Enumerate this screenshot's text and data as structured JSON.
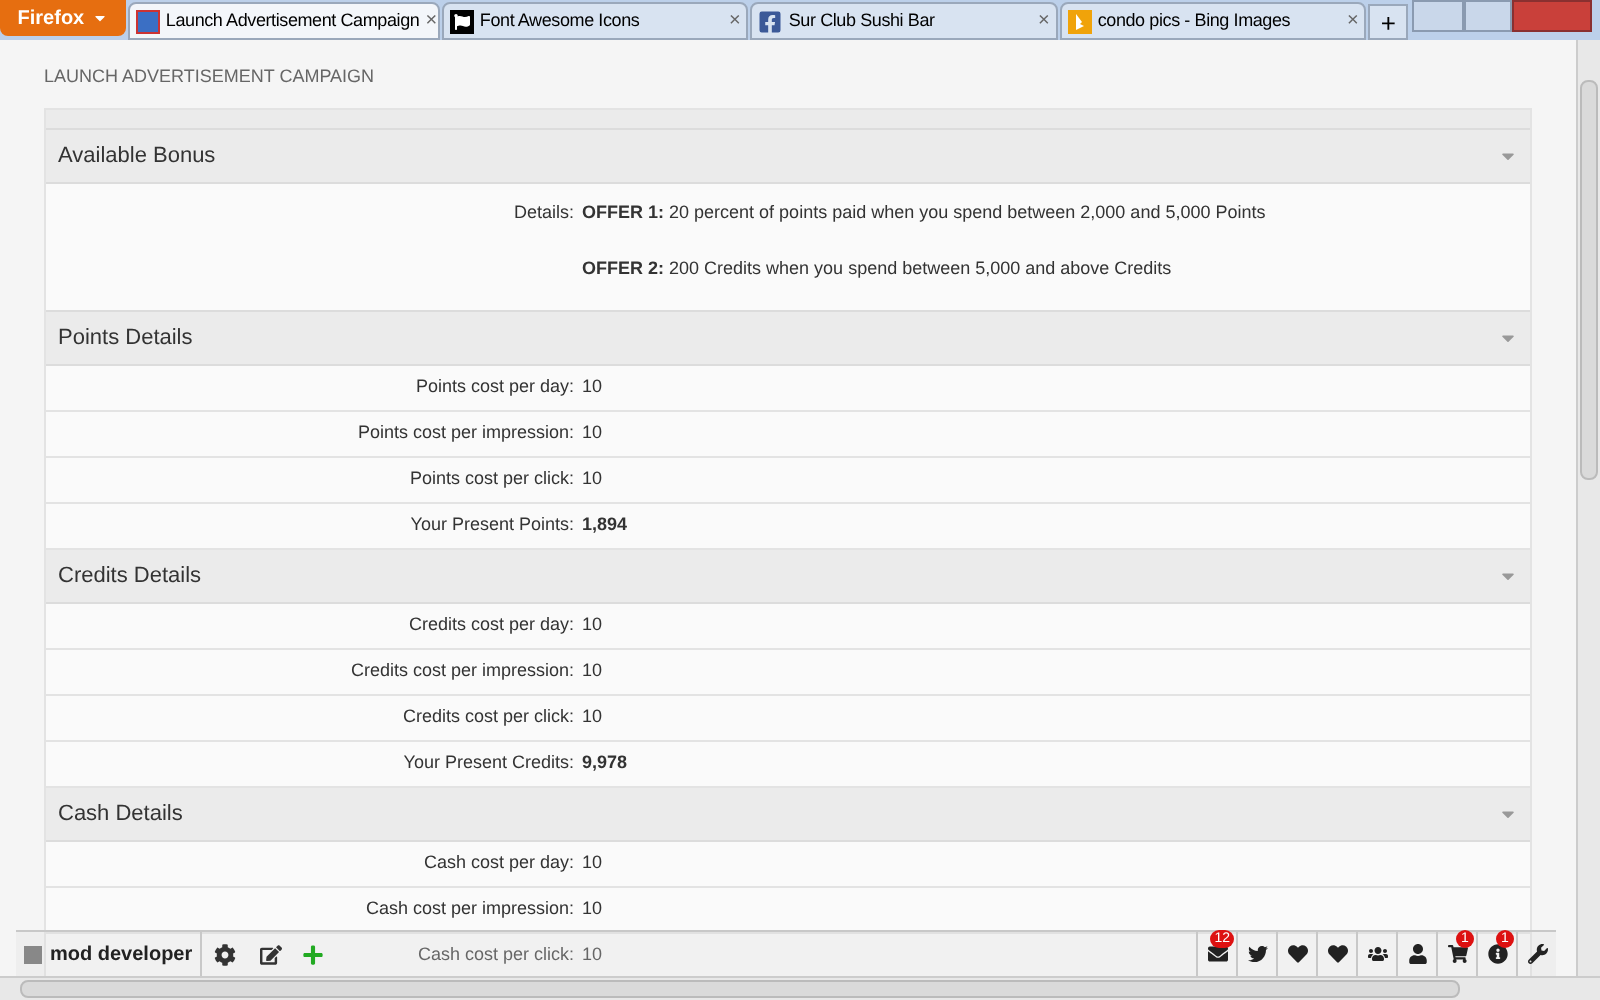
{
  "browser": {
    "menu_button": "Firefox",
    "tabs": [
      {
        "label": "Launch Advertisement Campaign",
        "selected": true,
        "kind": "app",
        "close": "×"
      },
      {
        "label": "Font Awesome Icons",
        "selected": false,
        "kind": "flag",
        "close": "×"
      },
      {
        "label": "Sur Club Sushi Bar",
        "selected": false,
        "kind": "facebook",
        "close": "×"
      },
      {
        "label": "condo pics - Bing Images",
        "selected": false,
        "kind": "bing",
        "close": "×"
      }
    ],
    "new_tab": "+"
  },
  "page": {
    "title": "LAUNCH ADVERTISEMENT CAMPAIGN",
    "bonus": {
      "heading": "Available Bonus",
      "label": "Details:",
      "offers": [
        "**OFFER 1:** 20 percent of points paid when you spend between 2,000 and 5,000 Points",
        "**OFFER 2:** 200 Credits when you spend between 5,000 and above Credits"
      ]
    },
    "sections": [
      {
        "heading": "Points Details",
        "rows": [
          {
            "label": "Points cost per day:",
            "value": "10",
            "emphasis": false
          },
          {
            "label": "Points cost per impression:",
            "value": "10",
            "emphasis": false
          },
          {
            "label": "Points cost per click:",
            "value": "10",
            "emphasis": false
          },
          {
            "label": "Your Present Points:",
            "value": "1,894",
            "emphasis": true
          }
        ]
      },
      {
        "heading": "Credits Details",
        "rows": [
          {
            "label": "Credits cost per day:",
            "value": "10",
            "emphasis": false
          },
          {
            "label": "Credits cost per impression:",
            "value": "10",
            "emphasis": false
          },
          {
            "label": "Credits cost per click:",
            "value": "10",
            "emphasis": false
          },
          {
            "label": "Your Present Credits:",
            "value": "9,978",
            "emphasis": true
          }
        ]
      },
      {
        "heading": "Cash Details",
        "rows": [
          {
            "label": "Cash cost per day:",
            "value": "10",
            "emphasis": false
          },
          {
            "label": "Cash cost per impression:",
            "value": "10",
            "emphasis": false
          },
          {
            "label": "Cash cost per click:",
            "value": "10",
            "emphasis": false
          }
        ]
      }
    ]
  },
  "toolbar": {
    "user": "mod developer",
    "icons": [
      {
        "kind": "mail",
        "badge": "12"
      },
      {
        "kind": "bird"
      },
      {
        "kind": "heart"
      },
      {
        "kind": "heart"
      },
      {
        "kind": "users"
      },
      {
        "kind": "user"
      },
      {
        "kind": "cart",
        "badge": "1"
      },
      {
        "kind": "info",
        "badge": "1"
      },
      {
        "kind": "wrench"
      }
    ]
  }
}
